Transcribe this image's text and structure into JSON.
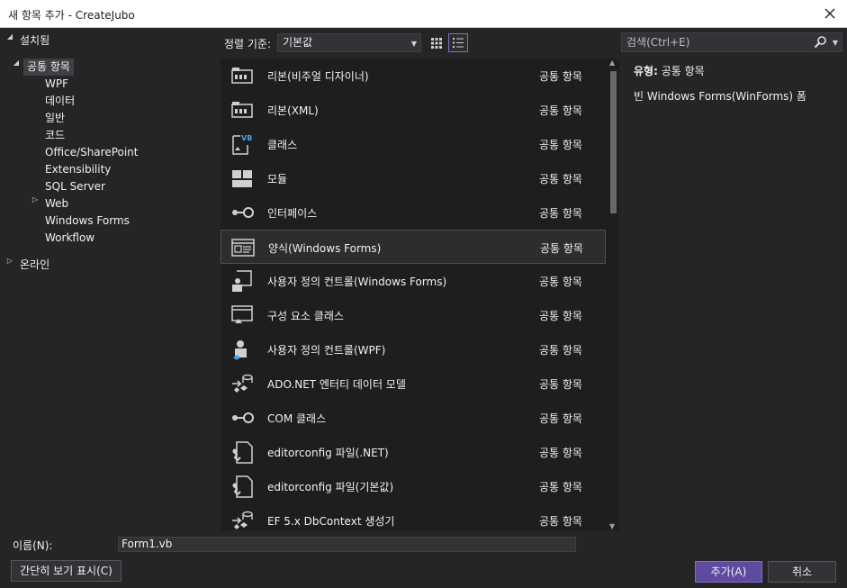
{
  "window": {
    "title": "새 항목 추가 - CreateJubo"
  },
  "tree": {
    "installed": "설치됨",
    "common": "공통 항목",
    "children": [
      "WPF",
      "데이터",
      "일반",
      "코드",
      "Office/SharePoint",
      "Extensibility",
      "SQL Server",
      "Web",
      "Windows Forms",
      "Workflow"
    ],
    "online": "온라인"
  },
  "sort": {
    "label": "정렬 기준:",
    "value": "기본값"
  },
  "templates": [
    {
      "name": "리본(비주얼 디자이너)",
      "category": "공통 항목",
      "icon": "ribbon-icon"
    },
    {
      "name": "리본(XML)",
      "category": "공통 항목",
      "icon": "ribbon-icon"
    },
    {
      "name": "클래스",
      "category": "공통 항목",
      "icon": "vb-class-icon"
    },
    {
      "name": "모듈",
      "category": "공통 항목",
      "icon": "module-icon"
    },
    {
      "name": "인터페이스",
      "category": "공통 항목",
      "icon": "interface-icon"
    },
    {
      "name": "양식(Windows Forms)",
      "category": "공통 항목",
      "icon": "form-icon"
    },
    {
      "name": "사용자 정의 컨트롤(Windows Forms)",
      "category": "공통 항목",
      "icon": "user-control-icon"
    },
    {
      "name": "구성 요소 클래스",
      "category": "공통 항목",
      "icon": "component-class-icon"
    },
    {
      "name": "사용자 정의 컨트롤(WPF)",
      "category": "공통 항목",
      "icon": "wpf-user-control-icon"
    },
    {
      "name": "ADO.NET 엔터티 데이터 모델",
      "category": "공통 항목",
      "icon": "entity-model-icon"
    },
    {
      "name": "COM 클래스",
      "category": "공통 항목",
      "icon": "interface-icon"
    },
    {
      "name": "editorconfig 파일(.NET)",
      "category": "공통 항목",
      "icon": "config-file-icon"
    },
    {
      "name": "editorconfig 파일(기본값)",
      "category": "공통 항목",
      "icon": "config-file-icon"
    },
    {
      "name": "EF 5.x DbContext 생성기",
      "category": "공통 항목",
      "icon": "entity-model-icon"
    }
  ],
  "selected_index": 5,
  "search": {
    "placeholder": "검색(Ctrl+E)"
  },
  "details": {
    "type_label": "유형:",
    "type_value": "공통 항목",
    "description": "빈 Windows Forms(WinForms) 폼"
  },
  "name_field": {
    "label": "이름(N):",
    "value": "Form1.vb"
  },
  "buttons": {
    "compact": "간단히 보기 표시(C)",
    "add": "추가(A)",
    "cancel": "취소"
  },
  "colors": {
    "accent": "#5e4a9f",
    "background": "#252526",
    "list_bg": "#1e1e1e"
  }
}
